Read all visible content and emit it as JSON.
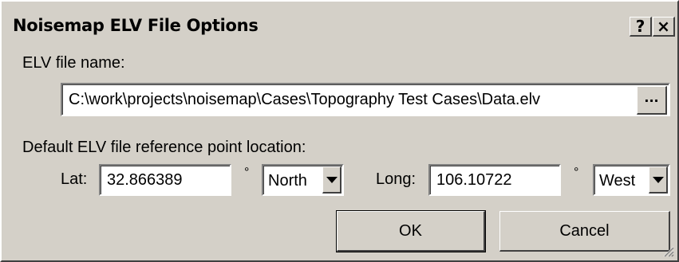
{
  "window": {
    "title": "Noisemap ELV File Options",
    "help_label": "?",
    "close_label": "×"
  },
  "file": {
    "label": "ELV file name:",
    "value": "C:\\work\\projects\\noisemap\\Cases\\Topography Test Cases\\Data.elv",
    "browse_label": "..."
  },
  "reference": {
    "section_label": "Default ELV file reference point location:",
    "lat_label": "Lat:",
    "lat_value": "32.866389",
    "lat_degree": "°",
    "lat_hemisphere": "North",
    "long_label": "Long:",
    "long_value": "106.10722",
    "long_degree": "°",
    "long_hemisphere": "West"
  },
  "buttons": {
    "ok_label": "OK",
    "cancel_label": "Cancel"
  },
  "colors": {
    "dialog_face": "#d4d0c8",
    "field_background": "#ffffff"
  }
}
